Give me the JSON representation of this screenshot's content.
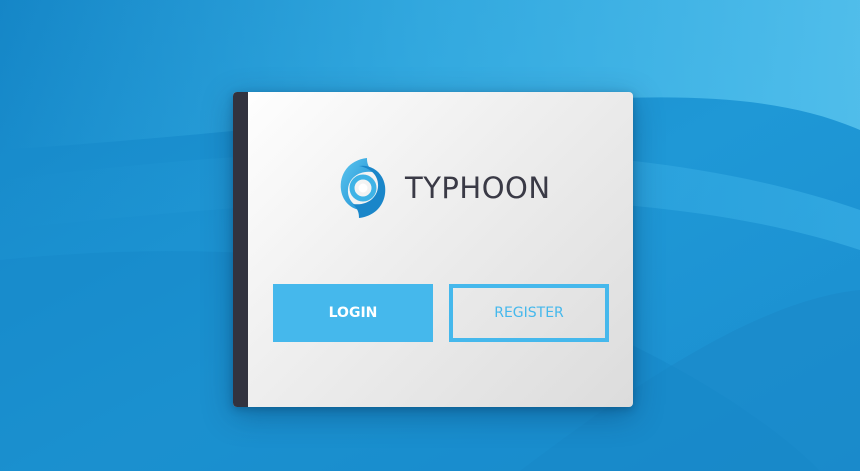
{
  "app": {
    "name": "TYPHOON",
    "logo_icon": "typhoon-swirl-icon"
  },
  "actions": {
    "login_label": "LOGIN",
    "register_label": "REGISTER"
  },
  "colors": {
    "background": "#1a8fd0",
    "accent": "#45b8ec",
    "stripe": "#32333f",
    "brand_text": "#3a3a46"
  }
}
